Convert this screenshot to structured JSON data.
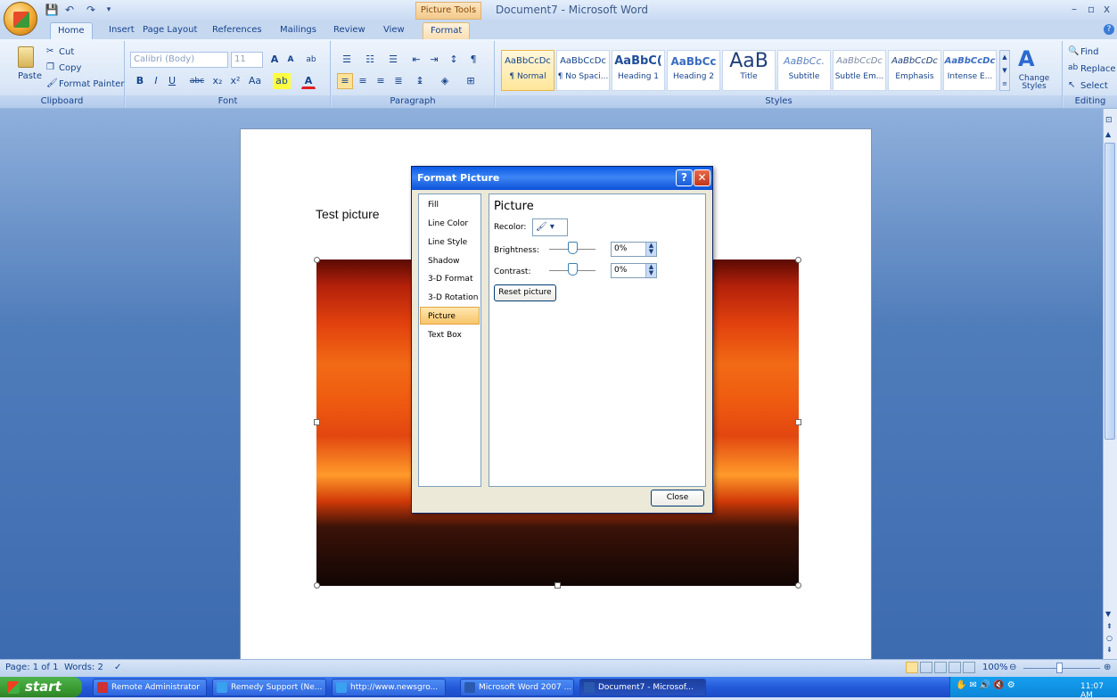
{
  "titlebar": {
    "context_tab": "Picture Tools",
    "window_title": "Document7 - Microsoft Word"
  },
  "tabs": [
    "Home",
    "Insert",
    "Page Layout",
    "References",
    "Mailings",
    "Review",
    "View",
    "Format"
  ],
  "ribbon": {
    "clipboard": {
      "paste": "Paste",
      "cut": "Cut",
      "copy": "Copy",
      "format_painter": "Format Painter",
      "label": "Clipboard"
    },
    "font": {
      "name": "Calibri (Body)",
      "size": "11",
      "label": "Font"
    },
    "paragraph": {
      "label": "Paragraph"
    },
    "styles": {
      "label": "Styles",
      "items": [
        {
          "preview": "AaBbCcDc",
          "name": "¶ Normal"
        },
        {
          "preview": "AaBbCcDc",
          "name": "¶ No Spaci..."
        },
        {
          "preview": "AaBbC(",
          "name": "Heading 1"
        },
        {
          "preview": "AaBbCc",
          "name": "Heading 2"
        },
        {
          "preview": "AaB",
          "name": "Title"
        },
        {
          "preview": "AaBbCc.",
          "name": "Subtitle"
        },
        {
          "preview": "AaBbCcDc",
          "name": "Subtle Em..."
        },
        {
          "preview": "AaBbCcDc",
          "name": "Emphasis"
        },
        {
          "preview": "AaBbCcDc",
          "name": "Intense E..."
        }
      ],
      "change_styles": "Change Styles"
    },
    "editing": {
      "find": "Find",
      "replace": "Replace",
      "select": "Select",
      "label": "Editing"
    }
  },
  "document": {
    "text": "Test picture"
  },
  "dialog": {
    "title": "Format Picture",
    "nav": [
      "Fill",
      "Line Color",
      "Line Style",
      "Shadow",
      "3-D Format",
      "3-D Rotation",
      "Picture",
      "Text Box"
    ],
    "selected_nav": "Picture",
    "pane_title": "Picture",
    "recolor_label": "Recolor:",
    "brightness_label": "Brightness:",
    "brightness_value": "0%",
    "contrast_label": "Contrast:",
    "contrast_value": "0%",
    "reset": "Reset picture",
    "close": "Close"
  },
  "statusbar": {
    "page": "Page: 1 of 1",
    "words": "Words: 2",
    "zoom": "100%"
  },
  "taskbar": {
    "start": "start",
    "tasks": [
      "Remote Administrator",
      "Remedy Support (Ne...",
      "http://www.newsgro...",
      "Microsoft Word 2007 ...",
      "Document7 - Microsof..."
    ],
    "clock": "11:07 AM"
  },
  "colors": {
    "ribbon_accent": "#15428b",
    "taskbar": "#235ad8",
    "start": "#3a9a32",
    "dialog_title": "#0a5ae6"
  }
}
